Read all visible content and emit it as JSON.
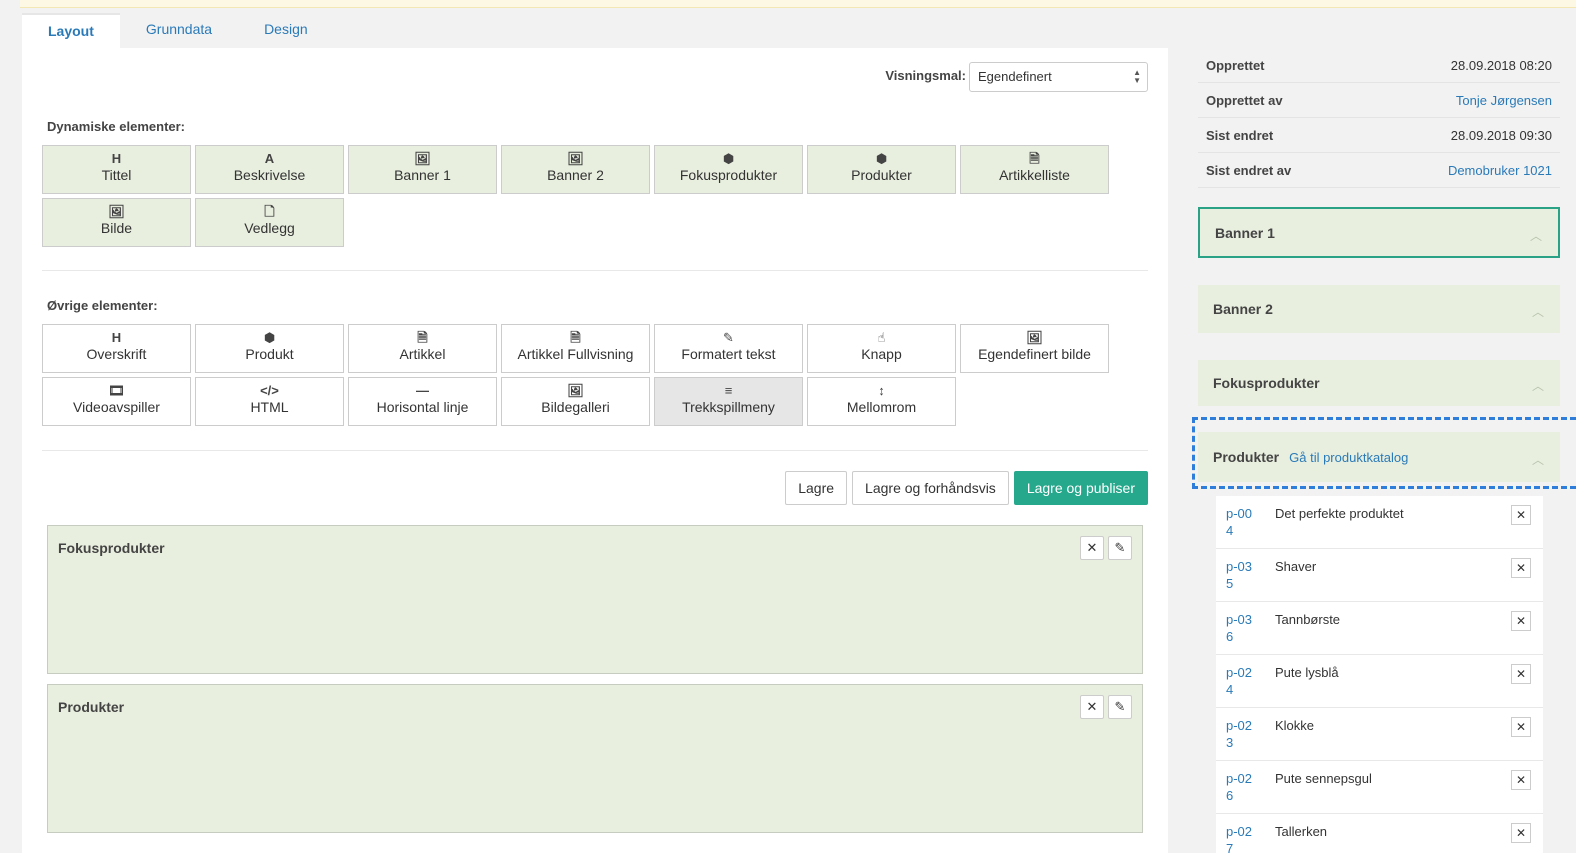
{
  "tabs": [
    {
      "label": "Layout"
    },
    {
      "label": "Grunndata"
    },
    {
      "label": "Design"
    }
  ],
  "visningsmal": {
    "label": "Visningsmal:",
    "value": "Egendefinert"
  },
  "dynamic": {
    "label": "Dynamiske elementer:",
    "items": [
      {
        "icon": "H",
        "label": "Tittel"
      },
      {
        "icon": "A",
        "label": "Beskrivelse"
      },
      {
        "icon": "🖼",
        "label": "Banner 1"
      },
      {
        "icon": "🖼",
        "label": "Banner 2"
      },
      {
        "icon": "⬢",
        "label": "Fokusprodukter"
      },
      {
        "icon": "⬢",
        "label": "Produkter"
      },
      {
        "icon": "🗎",
        "label": "Artikkelliste"
      },
      {
        "icon": "🖼",
        "label": "Bilde"
      },
      {
        "icon": "🗋",
        "label": "Vedlegg"
      }
    ]
  },
  "other": {
    "label": "Øvrige elementer:",
    "items": [
      {
        "icon": "H",
        "label": "Overskrift"
      },
      {
        "icon": "⬢",
        "label": "Produkt"
      },
      {
        "icon": "🗎",
        "label": "Artikkel"
      },
      {
        "icon": "🗎",
        "label": "Artikkel Fullvisning"
      },
      {
        "icon": "✎",
        "label": "Formatert tekst"
      },
      {
        "icon": "☝",
        "label": "Knapp"
      },
      {
        "icon": "🖼",
        "label": "Egendefinert bilde"
      },
      {
        "icon": "🎞",
        "label": "Videoavspiller"
      },
      {
        "icon": "</>",
        "label": "HTML"
      },
      {
        "icon": "—",
        "label": "Horisontal linje"
      },
      {
        "icon": "🖼",
        "label": "Bildegalleri"
      },
      {
        "icon": "≡",
        "label": "Trekkspillmeny"
      },
      {
        "icon": "↕",
        "label": "Mellomrom"
      }
    ]
  },
  "buttons": {
    "save": "Lagre",
    "preview": "Lagre og forhåndsvis",
    "publish": "Lagre og publiser"
  },
  "blocks": [
    {
      "title": "Fokusprodukter"
    },
    {
      "title": "Produkter"
    }
  ],
  "meta": [
    {
      "key": "Opprettet",
      "value": "28.09.2018 08:20"
    },
    {
      "key": "Opprettet av",
      "value": "Tonje Jørgensen"
    },
    {
      "key": "Sist endret",
      "value": "28.09.2018 09:30"
    },
    {
      "key": "Sist endret av",
      "value": "Demobruker 1021"
    }
  ],
  "panels": [
    {
      "title": "Banner 1"
    },
    {
      "title": "Banner 2"
    },
    {
      "title": "Fokusprodukter"
    },
    {
      "title": "Produkter",
      "link": "Gå til produktkatalog"
    }
  ],
  "products": [
    {
      "id": "p-004",
      "name": "Det perfekte produktet"
    },
    {
      "id": "p-035",
      "name": "Shaver"
    },
    {
      "id": "p-036",
      "name": "Tannbørste"
    },
    {
      "id": "p-024",
      "name": "Pute lysblå"
    },
    {
      "id": "p-023",
      "name": "Klokke"
    },
    {
      "id": "p-026",
      "name": "Pute sennepsgul"
    },
    {
      "id": "p-027",
      "name": "Tallerken"
    }
  ],
  "colors": {
    "accent": "#26a88c",
    "link": "#2a7ab8",
    "tile_bg": "#e8efdf",
    "highlight_dash": "#2f7ddb"
  }
}
